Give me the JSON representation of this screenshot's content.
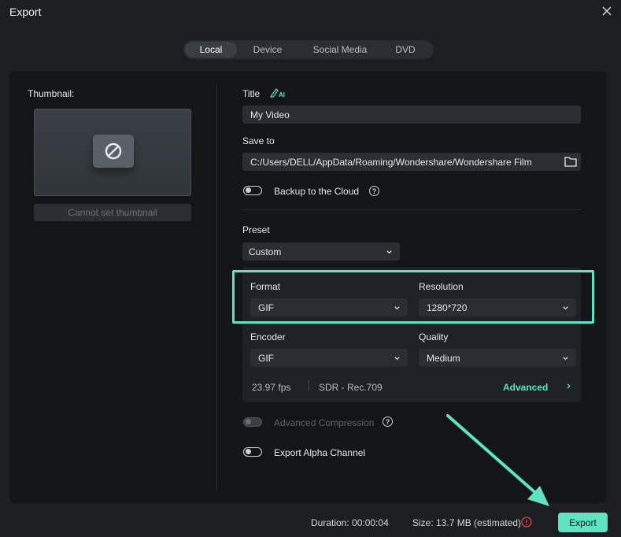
{
  "window": {
    "title": "Export"
  },
  "tabs": [
    {
      "label": "Local",
      "active": true
    },
    {
      "label": "Device",
      "active": false
    },
    {
      "label": "Social Media",
      "active": false
    },
    {
      "label": "DVD",
      "active": false
    }
  ],
  "thumbnail": {
    "label": "Thumbnail:",
    "button_label": "Cannot set thumbnail",
    "icon": "no-thumbnail-icon"
  },
  "title_field": {
    "label": "Title",
    "value": "My Video",
    "ai_icon": "ai-pen-icon"
  },
  "save_to": {
    "label": "Save to",
    "value": "C:/Users/DELL/AppData/Roaming/Wondershare/Wondershare Film",
    "icon": "folder-icon"
  },
  "backup": {
    "label": "Backup to the Cloud",
    "enabled": false
  },
  "preset": {
    "label": "Preset",
    "value": "Custom"
  },
  "format": {
    "label": "Format",
    "value": "GIF"
  },
  "resolution": {
    "label": "Resolution",
    "value": "1280*720"
  },
  "encoder": {
    "label": "Encoder",
    "value": "GIF"
  },
  "quality": {
    "label": "Quality",
    "value": "Medium"
  },
  "video_info": {
    "fps": "23.97 fps",
    "color": "SDR - Rec.709",
    "advanced_label": "Advanced"
  },
  "advanced_compression": {
    "label": "Advanced Compression",
    "enabled": false,
    "disabled": true
  },
  "alpha_channel": {
    "label": "Export Alpha Channel",
    "enabled": false
  },
  "footer": {
    "duration": "Duration: 00:00:04",
    "size": "Size:  13.7 MB (estimated)",
    "export_label": "Export"
  },
  "colors": {
    "accent": "#5fe3c3",
    "background": "#1c1e22",
    "panel": "#131517",
    "warning": "#e0403b"
  }
}
